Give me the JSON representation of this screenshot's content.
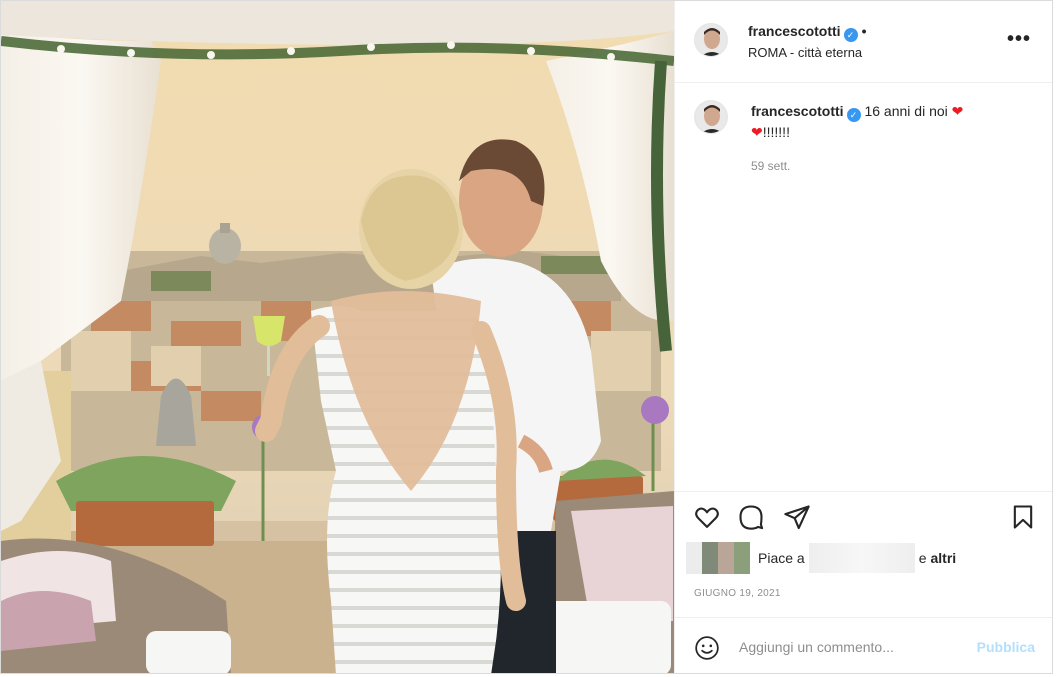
{
  "post": {
    "username": "francescototti",
    "location": "ROMA - città eterna",
    "more_menu": "•••",
    "header_dot": "•"
  },
  "caption": {
    "username": "francescototti",
    "text": "16 anni di noi",
    "suffix": "!!!!!!!",
    "time_ago": "59 sett."
  },
  "engagement": {
    "liked_by_prefix": "Piace a",
    "and_text": "e",
    "others_text": "altri",
    "date": "GIUGNO 19, 2021"
  },
  "comment_box": {
    "placeholder": "Aggiungi un commento...",
    "publish_label": "Pubblica"
  },
  "icons": {
    "verified": "verified-badge-icon",
    "like": "heart-outline-icon",
    "comment": "speech-bubble-icon",
    "share": "paper-plane-icon",
    "save": "bookmark-icon",
    "emoji": "smiley-icon",
    "caption_heart": "red-heart-emoji"
  },
  "colors": {
    "verified_blue": "#3897f0",
    "publish_disabled": "#b2dffc",
    "secondary_text": "#8e8e8e",
    "heart_red": "#ed1c24"
  }
}
